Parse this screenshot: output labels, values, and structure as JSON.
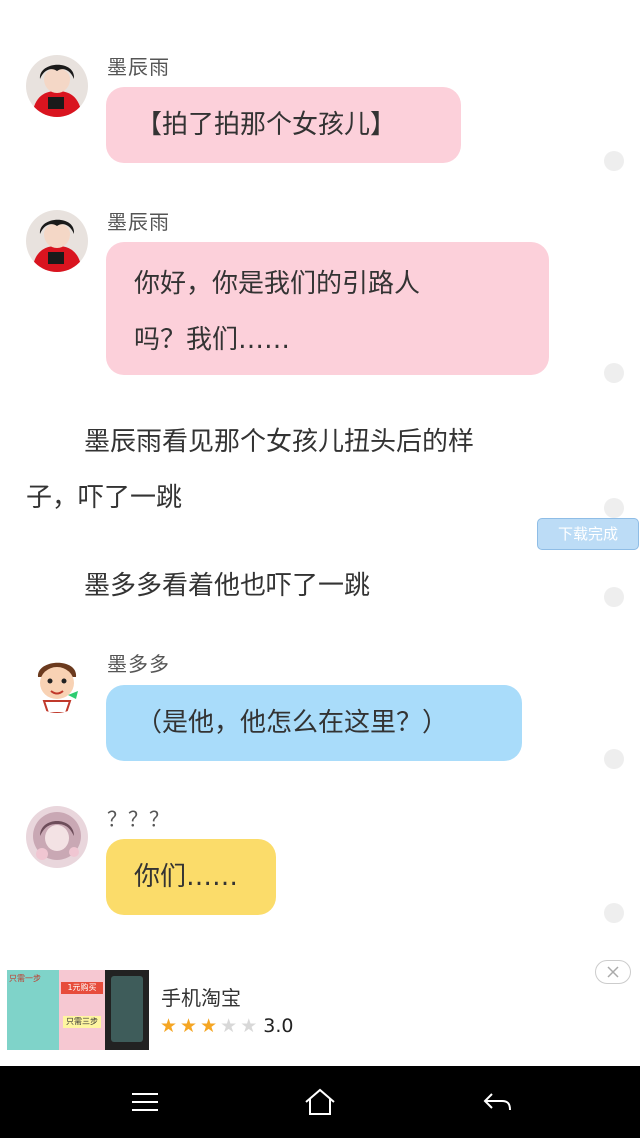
{
  "messages": [
    {
      "sender": "墨辰雨",
      "text": "【拍了拍那个女孩儿】"
    },
    {
      "sender": "墨辰雨",
      "line1": "你好，你是我们的引路人",
      "line2": "吗？我们……"
    },
    {
      "sender": "墨多多",
      "text": "（是他，他怎么在这里？）"
    },
    {
      "sender": "？？？",
      "text": "你们……"
    }
  ],
  "narration": {
    "p1_line1": "墨辰雨看见那个女孩儿扭头后的样",
    "p1_line2": "子，吓了一跳",
    "p2": "墨多多看着他也吓了一跳"
  },
  "download_badge": "下载完成",
  "ad": {
    "image_text_1": "只需一步",
    "image_text_2": "1元购买",
    "image_text_3": "只需三步",
    "app_name": "手机淘宝",
    "rating": 3.0,
    "rating_label": "3.0",
    "stars_total": 5
  },
  "colors": {
    "pink_bubble": "#fcd0da",
    "blue_bubble": "#a9dcfa",
    "yellow_bubble": "#fbdc6a",
    "download_badge": "#bcdcf6",
    "star_on": "#f5a623",
    "star_off": "#d8d8d8"
  },
  "icons": {
    "nav_menu": "menu-icon",
    "nav_home": "home-icon",
    "nav_back": "back-icon",
    "ad_close": "close-icon"
  }
}
